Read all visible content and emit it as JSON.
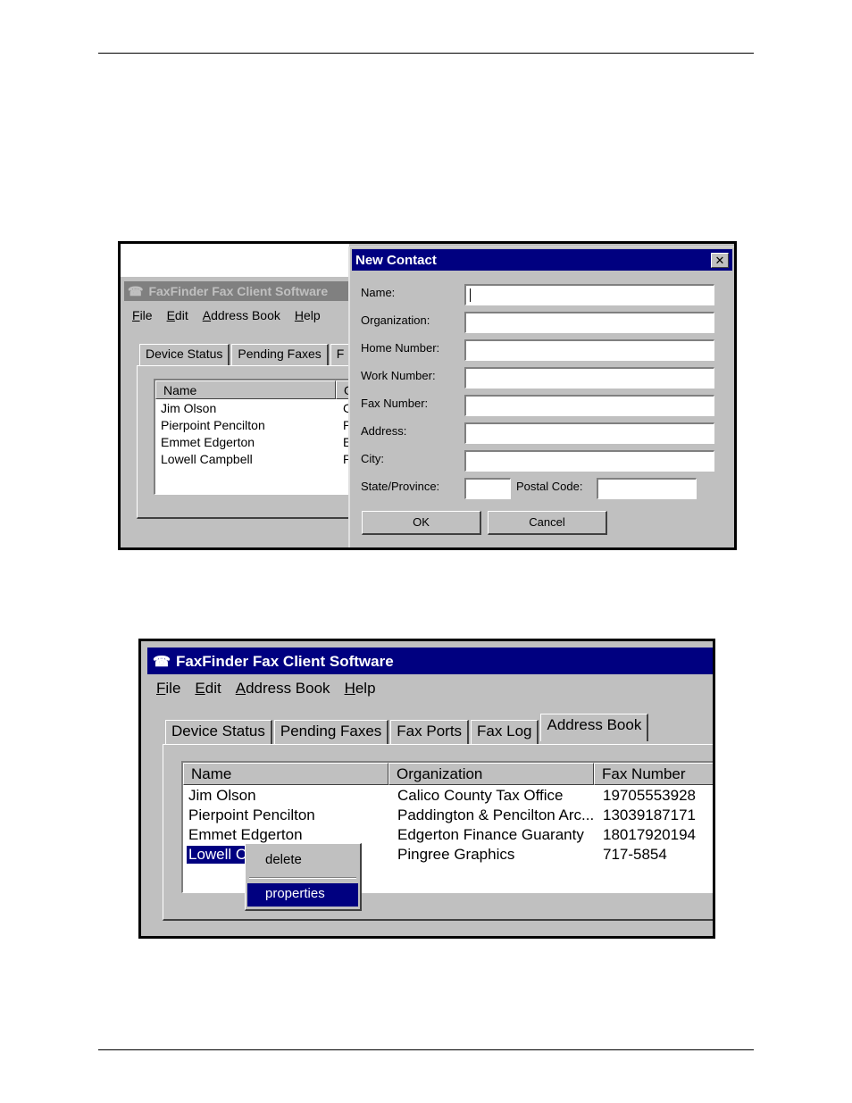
{
  "app": {
    "title": "FaxFinder Fax Client Software",
    "title_truncated": "FaxFinder Fax Client Software",
    "menu": [
      "File",
      "Edit",
      "Address Book",
      "Help"
    ]
  },
  "screenshot1": {
    "tabs": [
      "Device Status",
      "Pending Faxes",
      "F"
    ],
    "columns": [
      "Name",
      "O"
    ],
    "rows": [
      {
        "name": "Jim Olson",
        "org": "C"
      },
      {
        "name": "Pierpoint Pencilton",
        "org": "P"
      },
      {
        "name": "Emmet Edgerton",
        "org": "E"
      },
      {
        "name": "Lowell Campbell",
        "org": "P"
      }
    ],
    "dialog": {
      "title": "New Contact",
      "close_glyph": "✕",
      "fields": [
        {
          "label": "Name:",
          "value": ""
        },
        {
          "label": "Organization:",
          "value": ""
        },
        {
          "label": "Home Number:",
          "value": ""
        },
        {
          "label": "Work Number:",
          "value": ""
        },
        {
          "label": "Fax Number:",
          "value": ""
        },
        {
          "label": "Address:",
          "value": ""
        },
        {
          "label": "City:",
          "value": ""
        }
      ],
      "state_label": "State/Province:",
      "postal_label": "Postal Code:",
      "ok_label": "OK",
      "cancel_label": "Cancel"
    }
  },
  "screenshot2": {
    "tabs": [
      "Device Status",
      "Pending Faxes",
      "Fax Ports",
      "Fax Log",
      "Address Book"
    ],
    "active_tab": "Address Book",
    "columns": [
      "Name",
      "Organization",
      "Fax Number"
    ],
    "rows": [
      {
        "name": "Jim Olson",
        "org": "Calico County Tax Office",
        "fax": "19705553928"
      },
      {
        "name": "Pierpoint Pencilton",
        "org": "Paddington & Pencilton Arc...",
        "fax": "13039187171"
      },
      {
        "name": "Emmet Edgerton",
        "org": "Edgerton Finance Guaranty",
        "fax": "18017920194"
      },
      {
        "name": "Lowell Campbell",
        "org": "Pingree Graphics",
        "fax": "717-5854"
      }
    ],
    "context_menu": [
      "delete",
      "properties"
    ]
  },
  "colors": {
    "titlebar_active": "#000080",
    "titlebar_inactive": "#808080",
    "face": "#c0c0c0",
    "selection": "#000080"
  }
}
